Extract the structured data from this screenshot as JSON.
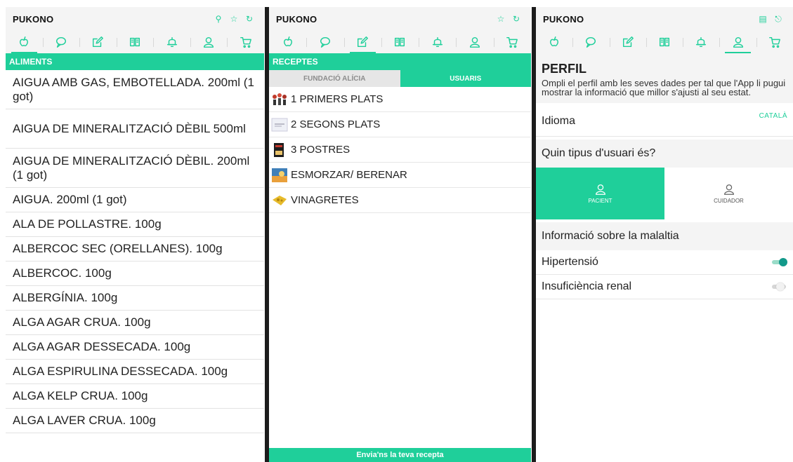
{
  "app_name": "PUKONO",
  "colors": {
    "accent": "#1fcf9a",
    "toggle_on": "#12998a",
    "panel_gray": "#f4f4f4"
  },
  "tabs": [
    "apple-icon",
    "chat-bubble-icon",
    "edit-icon",
    "book-icon",
    "bell-icon",
    "user-icon",
    "cart-icon"
  ],
  "panel1": {
    "top_icons": [
      "search-icon",
      "star-icon",
      "refresh-icon"
    ],
    "section_title": "ALIMENTS",
    "foods": [
      "AIGUA AMB GAS, EMBOTELLADA. 200ml (1 got)",
      "AIGUA DE MINERALITZACIÓ DÈBIL 500ml",
      "AIGUA DE MINERALITZACIÓ DÈBIL. 200ml (1 got)",
      "AIGUA. 200ml (1 got)",
      "ALA DE POLLASTRE. 100g",
      "ALBERCOC SEC (ORELLANES). 100g",
      "ALBERCOC. 100g",
      "ALBERGÍNIA. 100g",
      "ALGA AGAR CRUA. 100g",
      "ALGA AGAR DESSECADA. 100g",
      "ALGA ESPIRULINA DESSECADA. 100g",
      "ALGA KELP CRUA. 100g",
      "ALGA LAVER CRUA. 100g"
    ]
  },
  "panel2": {
    "top_icons": [
      "star-icon",
      "refresh-icon"
    ],
    "section_title": "RECEPTES",
    "subtabs": {
      "left": "FUNDACIÓ ALÍCIA",
      "right": "USUARIS"
    },
    "recipes": [
      {
        "label": "1 PRIMERS PLATS",
        "thumb": "people-thumb"
      },
      {
        "label": "2 SEGONS PLATS",
        "thumb": "document-thumb"
      },
      {
        "label": "3 POSTRES",
        "thumb": "dessert-thumb"
      },
      {
        "label": "ESMORZAR/ BERENAR",
        "thumb": "breakfast-thumb"
      },
      {
        "label": "VINAGRETES",
        "thumb": "vinaigrette-thumb"
      }
    ],
    "footer_button": "Envia'ns la teva recepta"
  },
  "panel3": {
    "top_icons": [
      "notes-icon",
      "share-icon"
    ],
    "title": "PERFIL",
    "description": "Ompli el perfil amb les seves dades per tal que l'App li pugui mostrar la informació que millor s'ajusti al seu estat.",
    "language_label": "Idioma",
    "language_value": "CATALÀ",
    "user_type_question": "Quin tipus d'usuari és?",
    "user_types": {
      "patient": "PACIENT",
      "caregiver": "CUIDADOR"
    },
    "disease_header": "Informació sobre la malaltia",
    "conditions": [
      {
        "label": "Hipertensió",
        "enabled": true
      },
      {
        "label": "Insuficiència renal",
        "enabled": false
      }
    ]
  }
}
